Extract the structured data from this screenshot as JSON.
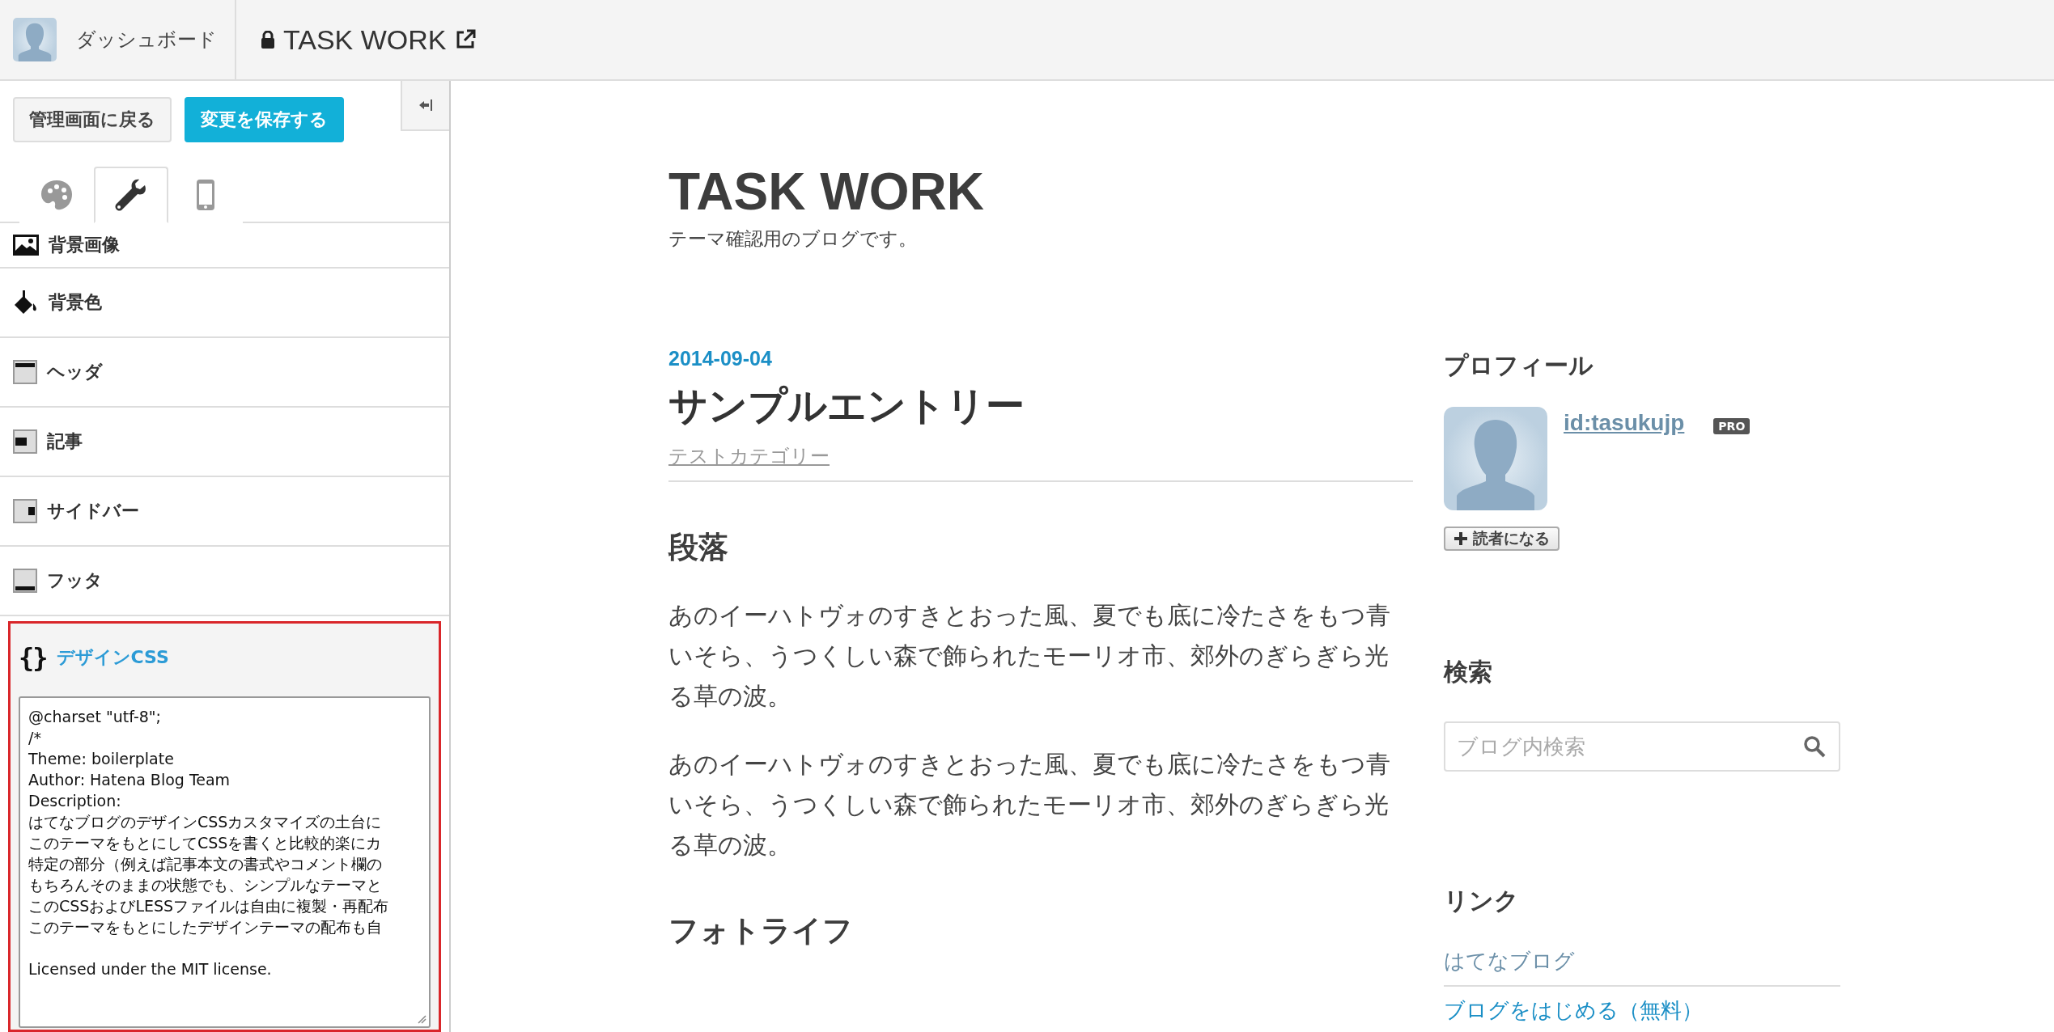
{
  "header": {
    "dashboard_label": "ダッシュボード",
    "blog_title": "TASK WORK"
  },
  "sidebar": {
    "buttons": [
      {
        "label": "管理画面に戻る",
        "kind": "plain"
      },
      {
        "label": "変更を保存する",
        "kind": "primary"
      }
    ],
    "tabs": [
      {
        "kind": "palette",
        "selected": false
      },
      {
        "kind": "wrench",
        "selected": true
      },
      {
        "kind": "phone",
        "selected": false
      }
    ],
    "sections": [
      {
        "kind": "image",
        "label": "背景画像"
      },
      {
        "kind": "bucket",
        "label": "背景色"
      },
      {
        "kind": "header",
        "label": "ヘッダ"
      },
      {
        "kind": "article",
        "label": "記事"
      },
      {
        "kind": "sidebar",
        "label": "サイドバー"
      },
      {
        "kind": "footer",
        "label": "フッタ"
      }
    ],
    "design_css": {
      "icon_text": "{}",
      "label": "デザインCSS",
      "expanded": true,
      "lines": [
        "@charset \"utf-8\";",
        "/*",
        "Theme: boilerplate",
        "Author: Hatena Blog Team",
        "Description:",
        "はてなブログのデザインCSSカスタマイズの土台に",
        "このテーマをもとにしてCSSを書くと比較的楽にカ",
        "特定の部分（例えば記事本文の書式やコメント欄の",
        "もちろんそのままの状態でも、シンプルなテーマと",
        "このCSSおよびLESSファイルは自由に複製・再配布",
        "このテーマをもとにしたデザインテーマの配布も自"
      ],
      "footer_lines": [
        "Licensed under the MIT license."
      ]
    }
  },
  "blog": {
    "title": "TASK WORK",
    "description": "テーマ確認用のブログです。",
    "entry": {
      "date": "2014-09-04",
      "title": "サンプルエントリー",
      "category": "テストカテゴリー",
      "body": [
        {
          "kind": "heading",
          "text": "段落"
        },
        {
          "kind": "paragraph",
          "text": "あのイーハトヴォのすきとおった風、夏でも底に冷たさをもつ青いそら、うつくしい森で飾られたモーリオ市、郊外のぎらぎら光る草の波。"
        },
        {
          "kind": "paragraph",
          "text": "あのイーハトヴォのすきとおった風、夏でも底に冷たさをもつ青いそら、うつくしい森で飾られたモーリオ市、郊外のぎらぎら光る草の波。"
        },
        {
          "kind": "heading",
          "text": "フォトライフ"
        }
      ]
    },
    "side": {
      "profile": {
        "heading": "プロフィール",
        "user_id": "id:tasukujp",
        "badge": "PRO",
        "subscribe": "読者になる"
      },
      "search": {
        "heading": "検索",
        "placeholder": "ブログ内検索"
      },
      "links": {
        "heading": "リンク",
        "items": [
          "はてなブログ",
          "ブログをはじめる（無料）"
        ]
      }
    }
  }
}
